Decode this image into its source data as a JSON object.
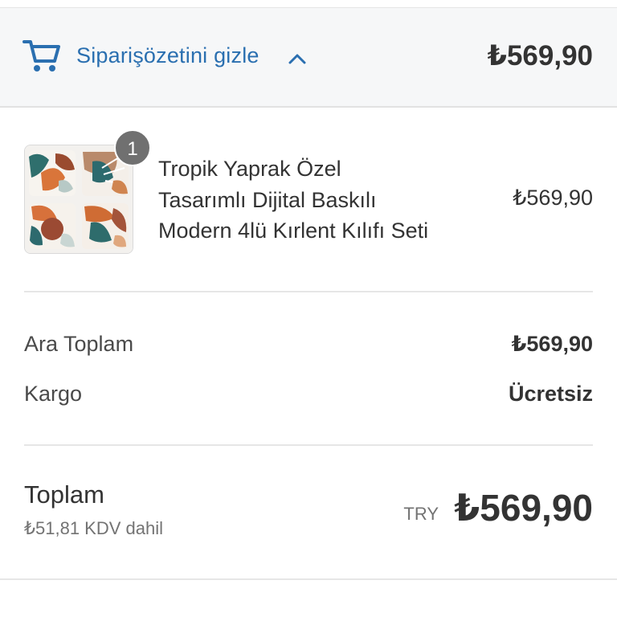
{
  "summary_bar": {
    "toggle_label": "Siparişözetini gizle",
    "total": "₺569,90",
    "icon": "cart-icon",
    "toggle_icon": "chevron-up-icon",
    "link_color": "#2a6fb0"
  },
  "cart": {
    "items": [
      {
        "quantity": "1",
        "title_lines": [
          "Tropik Yaprak Özel",
          "Tasarımlı Dijital Baskılı",
          "Modern 4lü Kırlent Kılıfı Seti"
        ],
        "price": "₺569,90"
      }
    ]
  },
  "totals": {
    "subtotal_label": "Ara Toplam",
    "subtotal_value": "₺569,90",
    "shipping_label": "Kargo",
    "shipping_value": "Ücretsiz",
    "total_label": "Toplam",
    "tax_note": "₺51,81 KDV dahil",
    "currency_code": "TRY",
    "total_value": "₺569,90"
  }
}
